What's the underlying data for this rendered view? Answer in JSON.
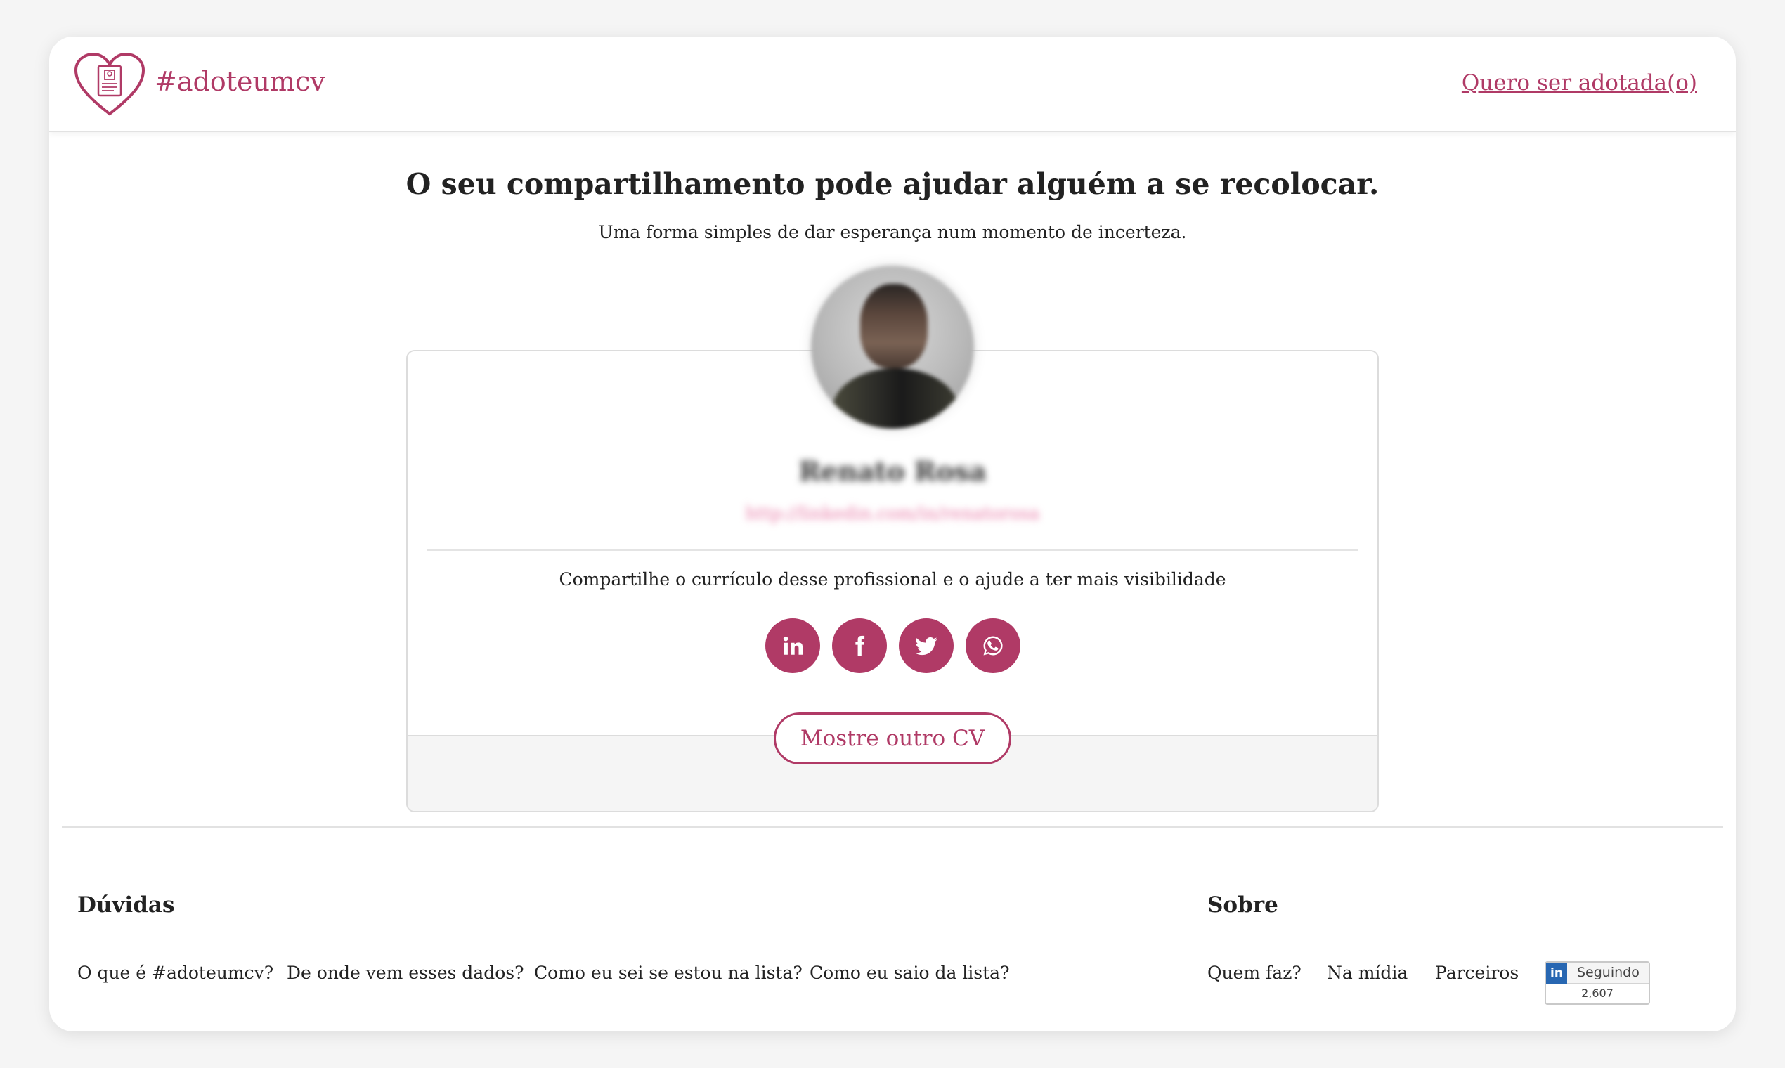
{
  "header": {
    "brand": "#adoteumcv",
    "cta_link": "Quero ser adotada(o)"
  },
  "hero": {
    "headline": "O seu compartilhamento pode ajudar alguém a se recolocar.",
    "subline": "Uma forma simples de dar esperança num momento de incerteza."
  },
  "profile": {
    "name": "Renato Rosa",
    "url": "http://linkedin.com/in/renatorosa",
    "share_text": "Compartilhe o currículo desse profissional e o ajude a ter mais visibilidade",
    "share_buttons": [
      {
        "network": "linkedin",
        "icon": "linkedin-icon"
      },
      {
        "network": "facebook",
        "icon": "facebook-icon"
      },
      {
        "network": "twitter",
        "icon": "twitter-icon"
      },
      {
        "network": "whatsapp",
        "icon": "whatsapp-icon"
      }
    ],
    "next_button": "Mostre outro CV"
  },
  "footer": {
    "doubts_heading": "Dúvidas",
    "doubts_links": [
      "O que é #adoteumcv?",
      "De onde vem esses dados?",
      "Como eu sei se estou na lista?",
      "Como eu saio da lista?"
    ],
    "about_heading": "Sobre",
    "about_links": [
      "Quem faz?",
      "Na mídia",
      "Parceiros"
    ],
    "follow_widget": {
      "badge": "in",
      "label": "Seguindo",
      "count": "2,607"
    }
  },
  "colors": {
    "accent": "#b03a66",
    "background": "#f5f5f5",
    "card_footer": "#f5f5f5"
  }
}
